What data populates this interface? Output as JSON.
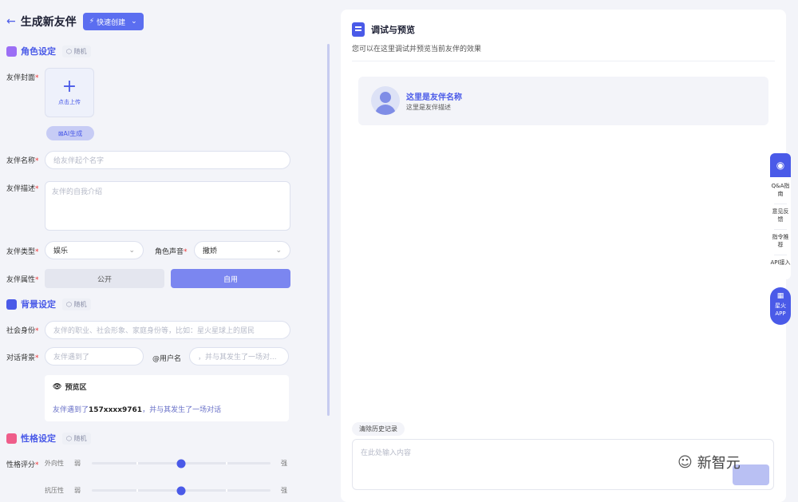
{
  "header": {
    "back_icon": "arrow-left-icon",
    "title": "生成新友伴",
    "quick_create": "快速创建"
  },
  "sections": {
    "role": {
      "title": "角色设定",
      "random": "随机",
      "color": "#9b6ef5"
    },
    "background": {
      "title": "背景设定",
      "random": "随机",
      "color": "#4a5ae8"
    },
    "personality": {
      "title": "性格设定",
      "random": "随机",
      "color": "#ef5d8a"
    }
  },
  "form": {
    "cover": {
      "label": "友伴封面",
      "upload_text": "点击上传",
      "ai_button": "AI生成"
    },
    "name": {
      "label": "友伴名称",
      "placeholder": "给友伴起个名字"
    },
    "desc": {
      "label": "友伴描述",
      "placeholder": "友伴的自我介绍"
    },
    "type": {
      "label": "友伴类型",
      "value": "娱乐"
    },
    "voice": {
      "label": "角色声音",
      "value": "撒娇"
    },
    "attribute": {
      "label": "友伴属性",
      "option_public": "公开",
      "option_private": "自用"
    },
    "social": {
      "label": "社会身份",
      "placeholder": "友伴的职业、社会形象、家庭身份等，比如：星火星球上的居民"
    },
    "dialog": {
      "label": "对话背景",
      "placeholder_1": "友伴遇到了",
      "at_user": "@用户名",
      "placeholder_2": "，并与其发生了一场对..."
    },
    "preview": {
      "title": "预览区",
      "text_1": "友伴遇到了",
      "user": "157xxxx9761",
      "text_2": "，并与其发生了一场对话"
    },
    "traits": {
      "label": "性格评分",
      "weak": "弱",
      "strong": "强",
      "items": [
        {
          "name": "外向性",
          "value": 0.5
        },
        {
          "name": "抗压性",
          "value": 0.5
        }
      ]
    }
  },
  "preview_panel": {
    "title": "调试与预览",
    "subtitle": "您可以在这里调试并预览当前友伴的效果",
    "card_name": "这里是友伴名称",
    "card_desc": "这里是友伴描述",
    "clear_history": "清除历史记录",
    "input_placeholder": "在此处输入内容"
  },
  "dock": {
    "items": [
      "Q&A指南",
      "意见反馈",
      "指令推荐",
      "API接入"
    ],
    "app": "星火APP"
  },
  "watermark": {
    "text": "新智元"
  },
  "colors": {
    "accent": "#4a5ae8",
    "accent_light": "#7b86f0",
    "required": "#e33333"
  }
}
